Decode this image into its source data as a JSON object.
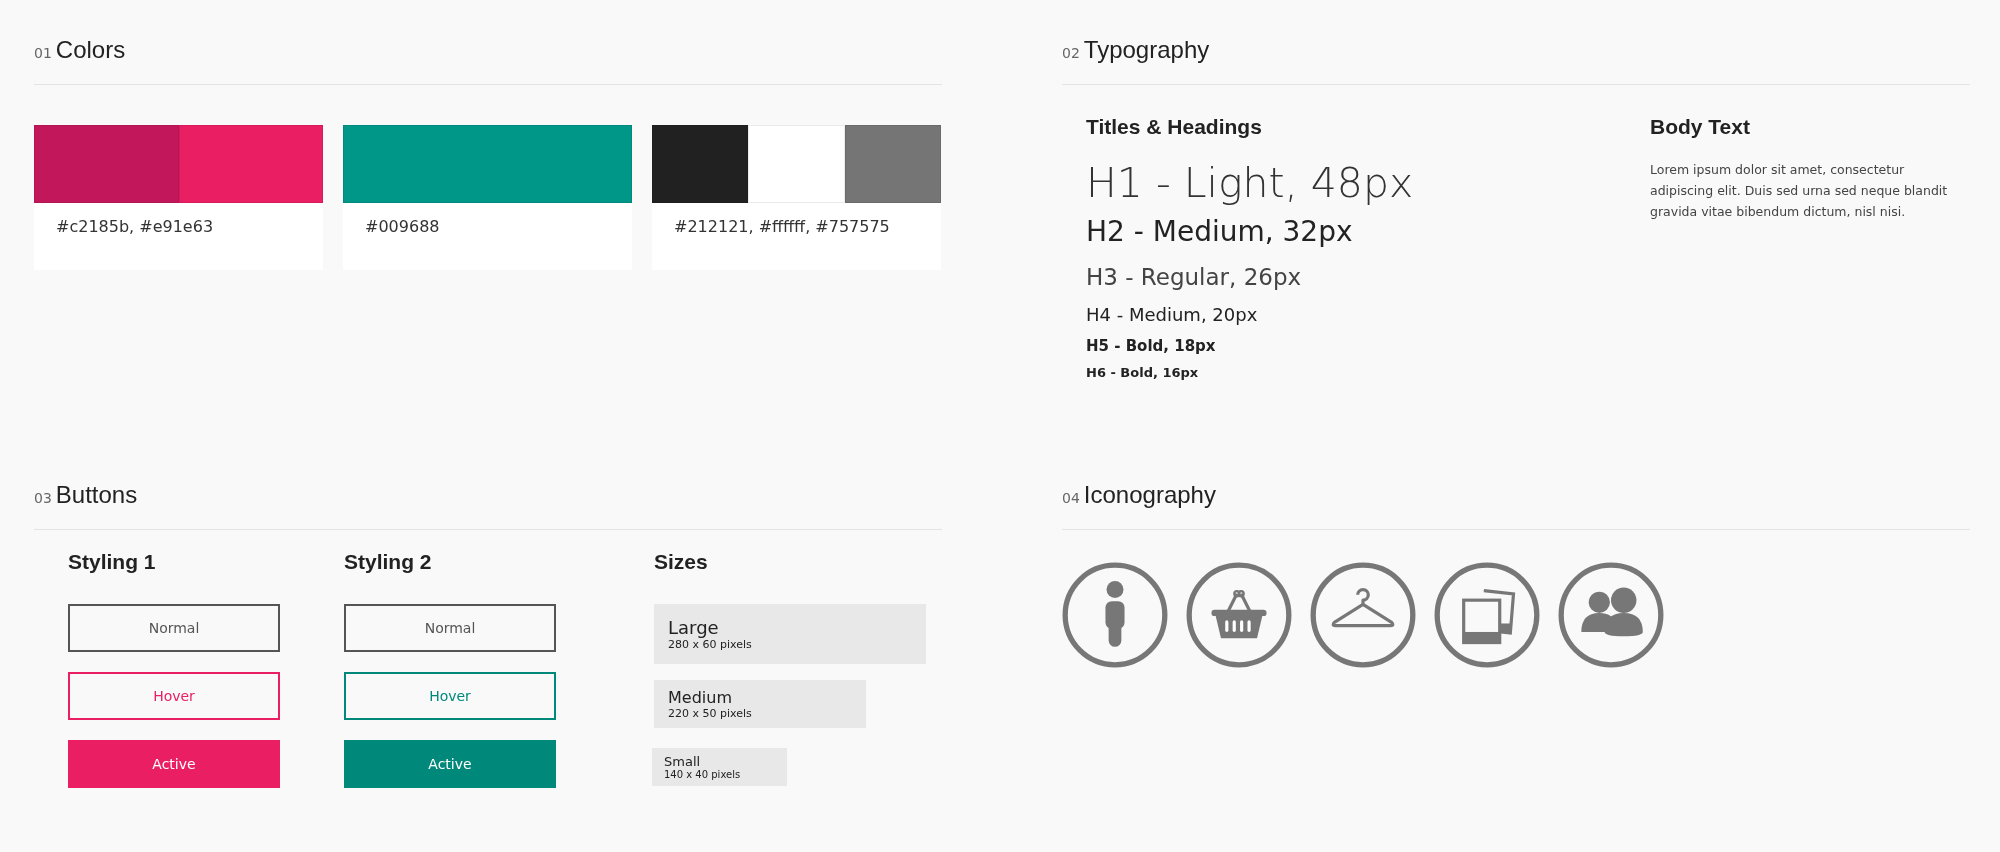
{
  "sections": [
    {
      "number": "01",
      "title": "Colors",
      "kind": "colors",
      "cards": [
        {
          "swatches": [
            {
              "color": "#c2185b"
            },
            {
              "color": "#e91e63"
            }
          ],
          "label": "#c2185b, #e91e63"
        },
        {
          "swatches": [
            {
              "color": "#009688"
            }
          ],
          "label": "#009688"
        },
        {
          "swatches": [
            {
              "color": "#212121"
            },
            {
              "color": "#ffffff"
            },
            {
              "color": "#757575"
            }
          ],
          "label": "#212121, #ffffff, #757575"
        }
      ]
    },
    {
      "number": "02",
      "title": "Typography",
      "kind": "typography",
      "headings_title": "Titles & Headings",
      "headings": [
        {
          "kind": "h1",
          "text": "H1 - Light, 48px"
        },
        {
          "kind": "h2",
          "text": "H2 - Medium, 32px"
        },
        {
          "kind": "h3",
          "text": "H3 - Regular, 26px"
        },
        {
          "kind": "h4",
          "text": "H4 - Medium, 20px"
        },
        {
          "kind": "h5",
          "text": "H5 - Bold, 18px"
        },
        {
          "kind": "h6",
          "text": "H6 - Bold, 16px"
        }
      ],
      "body_title": "Body Text",
      "body": "Lorem ipsum dolor sit amet, consectetur adipiscing elit. Duis sed urna sed neque blandit gravida vitae bibendum dictum, nisl nisi."
    },
    {
      "number": "03",
      "title": "Buttons",
      "kind": "buttons",
      "stylings": [
        {
          "title": "Styling 1",
          "color": "#e91e63",
          "buttons": [
            {
              "kind": "normal",
              "label": "Normal"
            },
            {
              "kind": "hover",
              "label": "Hover"
            },
            {
              "kind": "active",
              "label": "Active"
            }
          ]
        },
        {
          "title": "Styling 2",
          "color": "#00897b",
          "buttons": [
            {
              "kind": "normal",
              "label": "Normal"
            },
            {
              "kind": "hover",
              "label": "Hover"
            },
            {
              "kind": "active",
              "label": "Active"
            }
          ]
        }
      ],
      "sizes_title": "Sizes",
      "sizes": [
        {
          "kind": "large",
          "label": "Large",
          "dimensions": "280 x 60 pixels"
        },
        {
          "kind": "medium",
          "label": "Medium",
          "dimensions": "220 x 50 pixels"
        },
        {
          "kind": "small",
          "label": "Small",
          "dimensions": "140 x 40 pixels"
        }
      ]
    },
    {
      "number": "04",
      "title": "Iconography",
      "kind": "icons",
      "icons": [
        {
          "kind": "person"
        },
        {
          "kind": "basket"
        },
        {
          "kind": "hanger"
        },
        {
          "kind": "photos"
        },
        {
          "kind": "users"
        }
      ]
    }
  ]
}
